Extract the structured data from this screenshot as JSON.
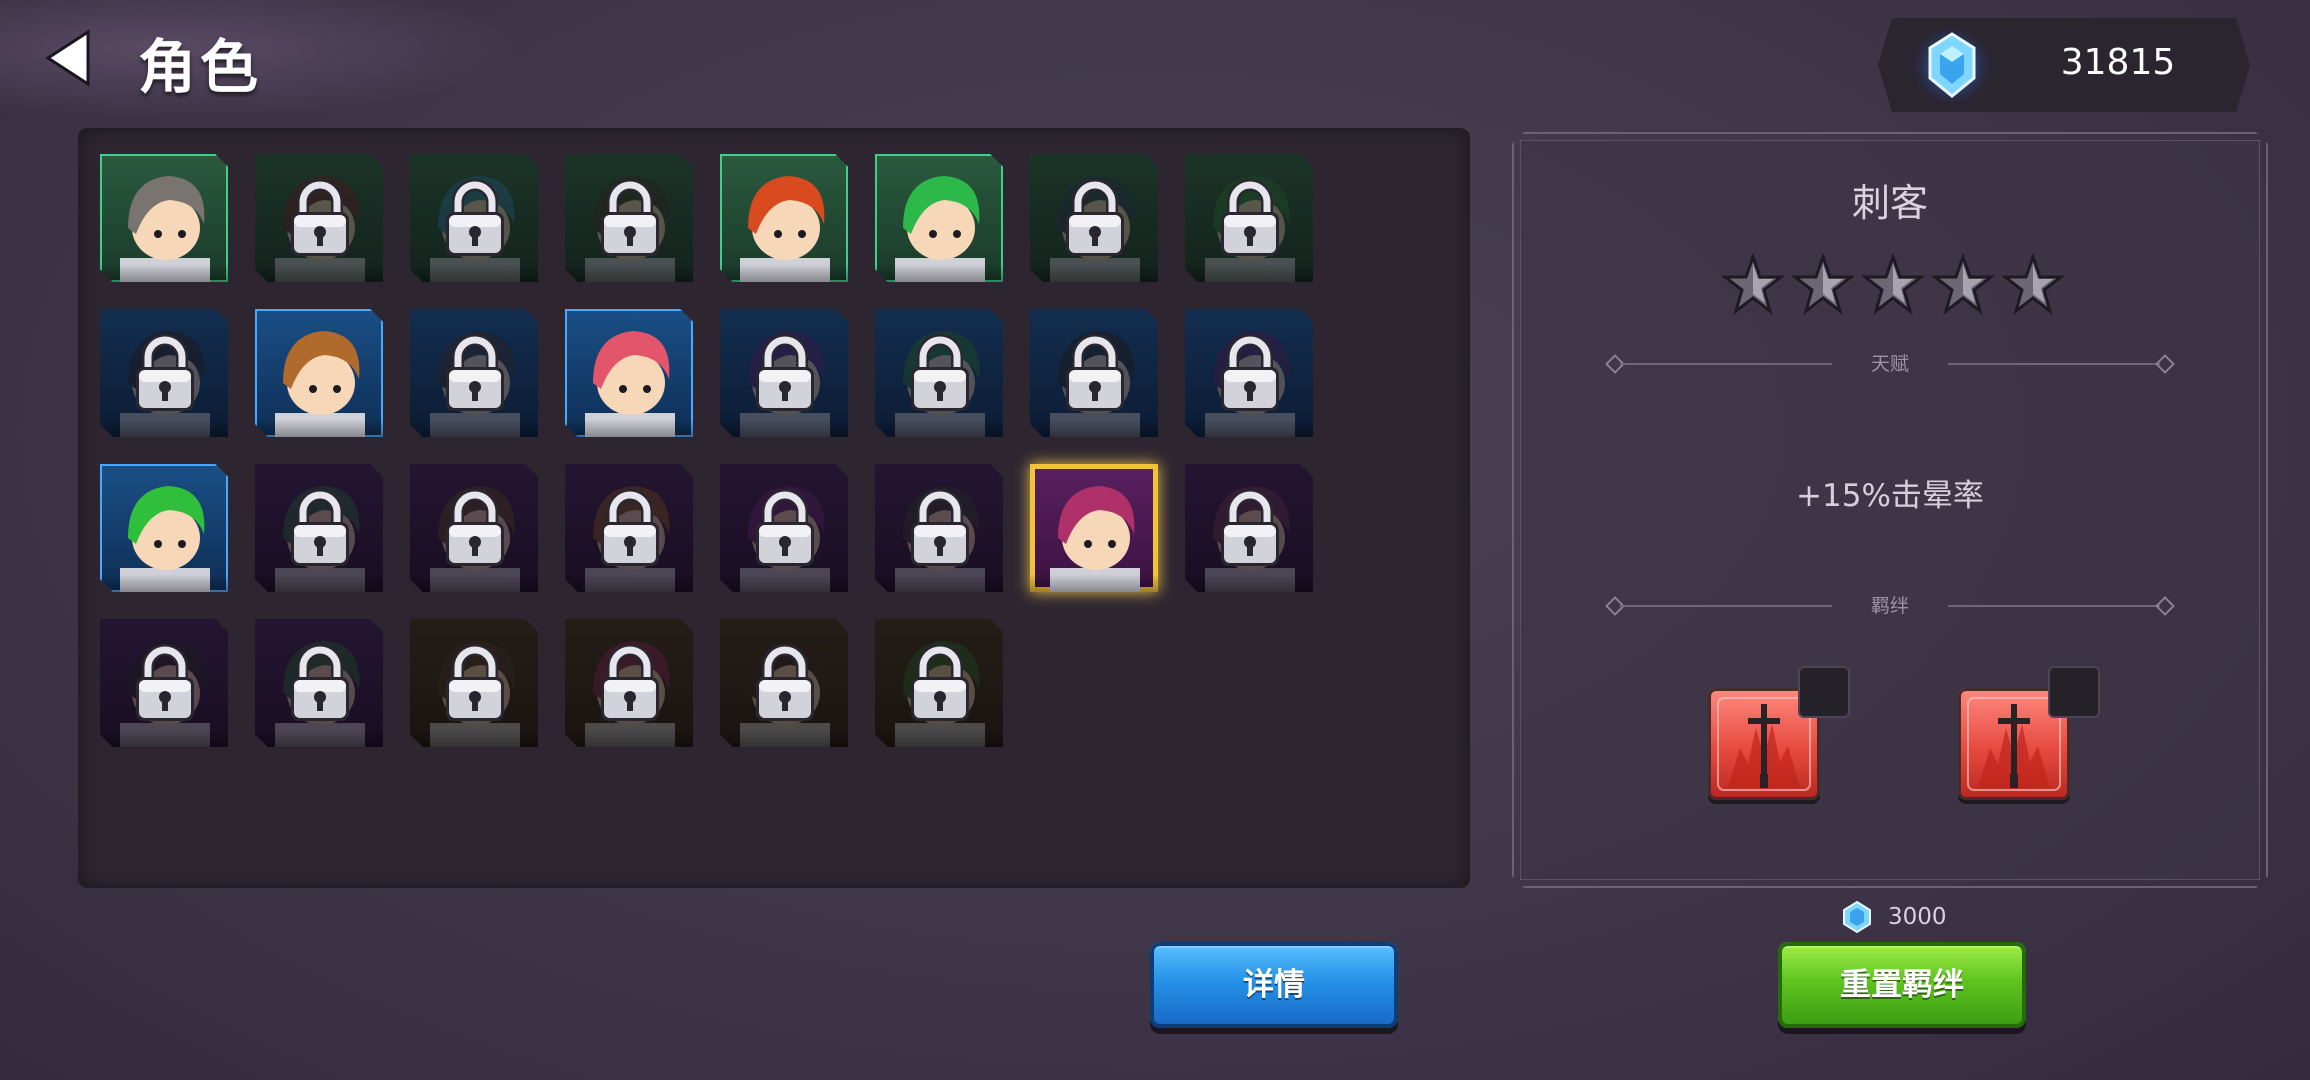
{
  "header": {
    "title": "角色",
    "currency": {
      "icon": "blue-gem-icon",
      "amount": "31815"
    }
  },
  "characters": [
    {
      "id": "c1",
      "state": "unlocked",
      "frame": "green",
      "hair": "#7a7470"
    },
    {
      "id": "c2",
      "state": "locked",
      "frame": "green",
      "hair": "#6a2b2b"
    },
    {
      "id": "c3",
      "state": "locked",
      "frame": "green",
      "hair": "#2c7fa0"
    },
    {
      "id": "c4",
      "state": "locked",
      "frame": "green",
      "hair": "#3a3a2a"
    },
    {
      "id": "c5",
      "state": "unlocked",
      "frame": "green",
      "hair": "#d94a1e"
    },
    {
      "id": "c6",
      "state": "unlocked",
      "frame": "green",
      "hair": "#2db84a"
    },
    {
      "id": "c7",
      "state": "locked",
      "frame": "green",
      "hair": "#2a3f55"
    },
    {
      "id": "c8",
      "state": "locked",
      "frame": "green",
      "hair": "#2f7a3a"
    },
    {
      "id": "c9",
      "state": "locked",
      "frame": "blue",
      "hair": "#2a2a2a"
    },
    {
      "id": "c10",
      "state": "unlocked",
      "frame": "blue",
      "hair": "#b06a2c"
    },
    {
      "id": "c11",
      "state": "locked",
      "frame": "blue",
      "hair": "#3a3a3a"
    },
    {
      "id": "c12",
      "state": "unlocked",
      "frame": "blue",
      "hair": "#e2556a"
    },
    {
      "id": "c13",
      "state": "locked",
      "frame": "blue",
      "hair": "#5a2a7a"
    },
    {
      "id": "c14",
      "state": "locked",
      "frame": "blue",
      "hair": "#2a7a3a"
    },
    {
      "id": "c15",
      "state": "locked",
      "frame": "blue",
      "hair": "#2a2a2a"
    },
    {
      "id": "c16",
      "state": "locked",
      "frame": "blue",
      "hair": "#5a2a6a"
    },
    {
      "id": "c17",
      "state": "unlocked",
      "frame": "blue",
      "hair": "#2fbf3a"
    },
    {
      "id": "c18",
      "state": "locked",
      "frame": "purple",
      "hair": "#2a6a4a"
    },
    {
      "id": "c19",
      "state": "locked",
      "frame": "purple",
      "hair": "#5a4a2a"
    },
    {
      "id": "c20",
      "state": "locked",
      "frame": "purple",
      "hair": "#8a5a2a"
    },
    {
      "id": "c21",
      "state": "locked",
      "frame": "purple",
      "hair": "#6a2a7a"
    },
    {
      "id": "c22",
      "state": "locked",
      "frame": "purple",
      "hair": "#3a3a3a"
    },
    {
      "id": "c23",
      "state": "selected",
      "frame": "purple",
      "hair": "#b0306a"
    },
    {
      "id": "c24",
      "state": "locked",
      "frame": "purple",
      "hair": "#6a3a5a"
    },
    {
      "id": "c25",
      "state": "locked",
      "frame": "purple",
      "hair": "#2a2a2a"
    },
    {
      "id": "c26",
      "state": "locked",
      "frame": "purple",
      "hair": "#2a6a3a"
    },
    {
      "id": "c27",
      "state": "locked",
      "frame": "gold",
      "hair": "#4a3a2a"
    },
    {
      "id": "c28",
      "state": "locked",
      "frame": "gold",
      "hair": "#8a2a5a"
    },
    {
      "id": "c29",
      "state": "locked",
      "frame": "gold",
      "hair": "#3a2a2a"
    },
    {
      "id": "c30",
      "state": "locked",
      "frame": "gold",
      "hair": "#2a6a2a"
    }
  ],
  "detail": {
    "class_name": "刺客",
    "stars": 5,
    "talent_label": "天赋",
    "talent_text": "+15%击晕率",
    "bond_label": "羁绊",
    "bond_cards": [
      {
        "icon": "sword-card-icon"
      },
      {
        "icon": "sword-card-icon"
      }
    ]
  },
  "reset_cost": {
    "icon": "blue-gem-icon",
    "amount": "3000"
  },
  "buttons": {
    "detail_label": "详情",
    "reset_label": "重置羁绊"
  },
  "colors": {
    "frame_green": "#1f4a32",
    "frame_blue": "#103a66",
    "frame_purple": "#2d1840",
    "frame_gold": "#2d2616",
    "selected": "#f2c23a"
  }
}
